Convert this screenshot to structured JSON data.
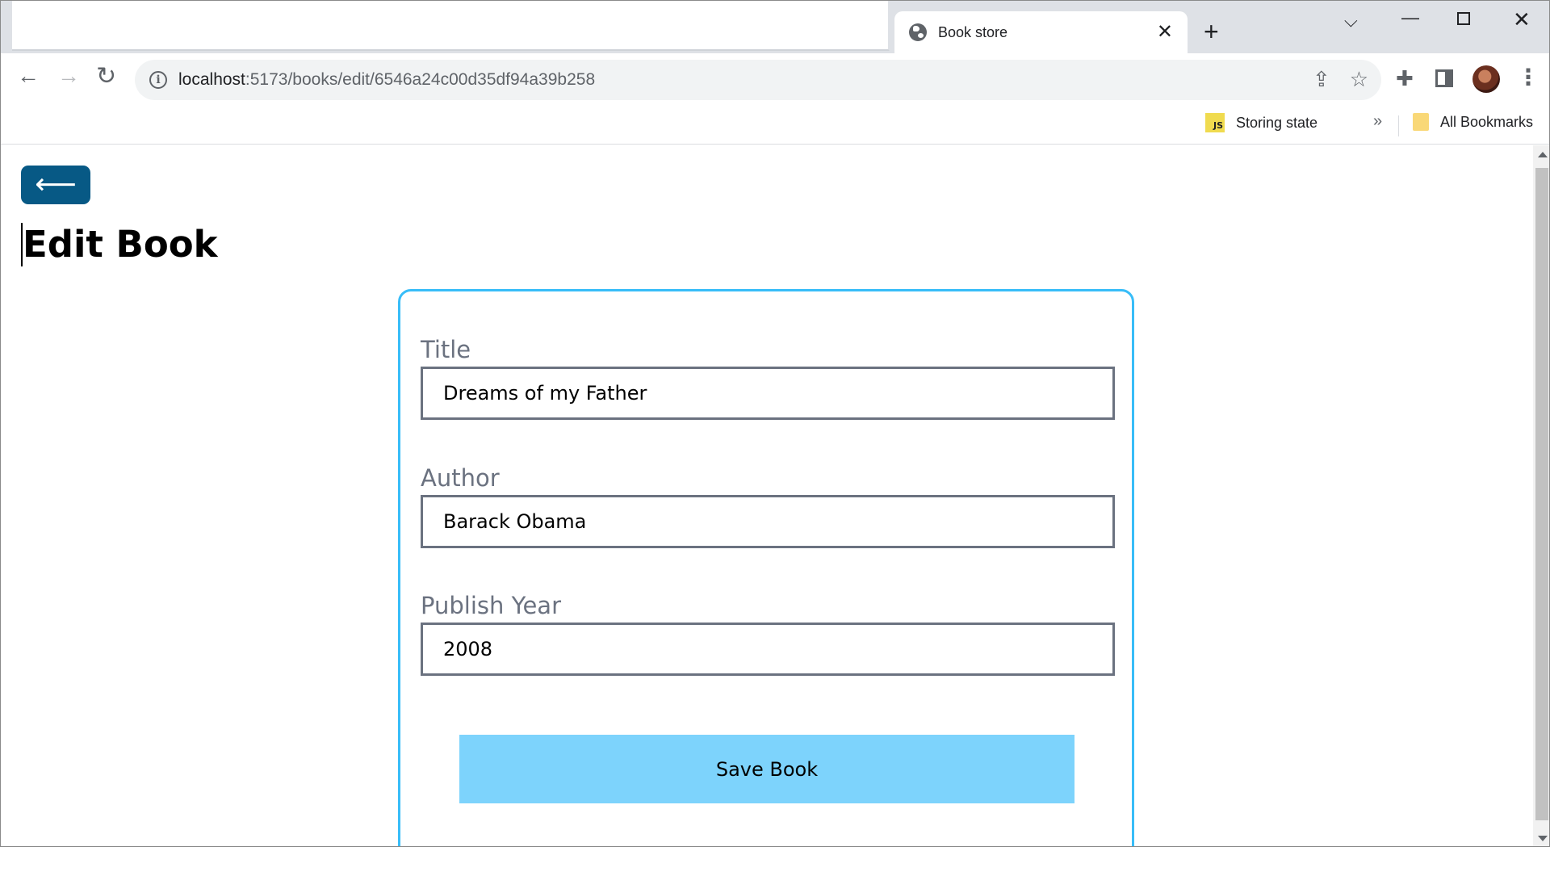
{
  "browser": {
    "tab_title": "Book store",
    "tab_close": "✕",
    "new_tab": "+",
    "controls": {
      "chevron": "⌵",
      "minimize": "—",
      "close": "✕"
    },
    "url_host": "localhost",
    "url_path": ":5173/books/edit/6546a24c00d35df94a39b258",
    "info_glyph": "i",
    "nav": {
      "back": "←",
      "forward": "→",
      "reload": "↻"
    },
    "omni_icons": {
      "share": "⇪",
      "star": "☆"
    },
    "toolbar_icons": {
      "extensions": "✚",
      "menu": "⋮"
    },
    "bookmarks": {
      "js_badge": "JS",
      "js_label": "Storing state",
      "more": "»",
      "all_label": "All Bookmarks"
    }
  },
  "page": {
    "back_arrow": "⟵",
    "title": "Edit Book",
    "fields": {
      "title_label": "Title",
      "title_value": "Dreams of my Father",
      "author_label": "Author",
      "author_value": "Barack Obama",
      "year_label": "Publish Year",
      "year_value": "2008"
    },
    "save_label": "Save Book"
  },
  "colors": {
    "back_button": "#075985",
    "card_border": "#38bdf8",
    "save_button": "#7dd3fc",
    "input_border": "#6b7280",
    "label_text": "#6b7280"
  }
}
